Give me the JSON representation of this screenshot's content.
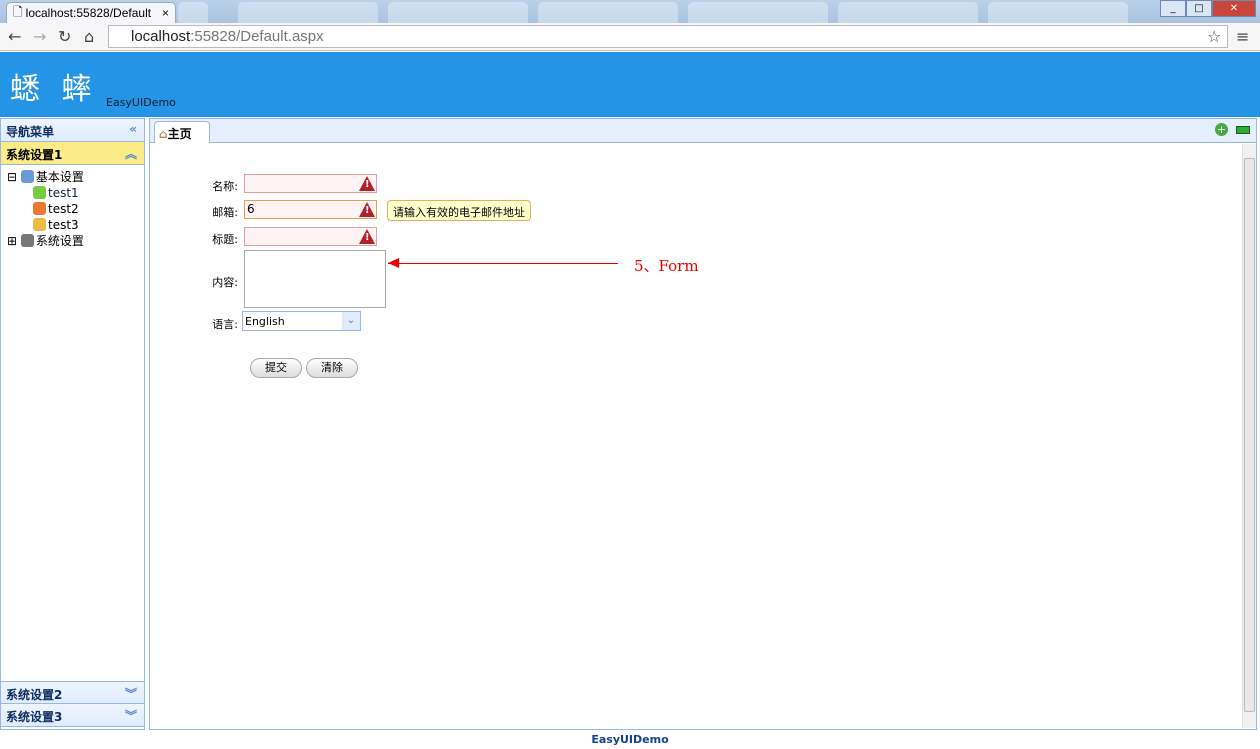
{
  "browser": {
    "tab_title": "localhost:55828/Default",
    "url_host": "localhost",
    "url_rest": ":55828/Default.aspx"
  },
  "header": {
    "logo": "蟋 蟀",
    "app_name": "EasyUIDemo"
  },
  "sidebar": {
    "title": "导航菜单",
    "sections": [
      {
        "label": "系统设置1",
        "expanded": true
      },
      {
        "label": "系统设置2"
      },
      {
        "label": "系统设置3"
      }
    ],
    "tree": {
      "root": "基本设置",
      "children": [
        "test1",
        "test2",
        "test3"
      ],
      "sibling": "系统设置"
    }
  },
  "tabs": [
    {
      "label": "主页",
      "icon": "home-icon"
    }
  ],
  "form": {
    "name_label": "名称:",
    "email_label": "邮箱:",
    "email_value": "6",
    "title_label": "标题:",
    "content_label": "内容:",
    "lang_label": "语言:",
    "lang_value": "English",
    "tooltip": "请输入有效的电子邮件地址",
    "submit": "提交",
    "clear": "清除"
  },
  "annotation": "5、Form",
  "footer": "EasyUIDemo",
  "colors": {
    "header": "#2394e6",
    "selected_section": "#fbec88",
    "annotation": "#ee0000"
  }
}
